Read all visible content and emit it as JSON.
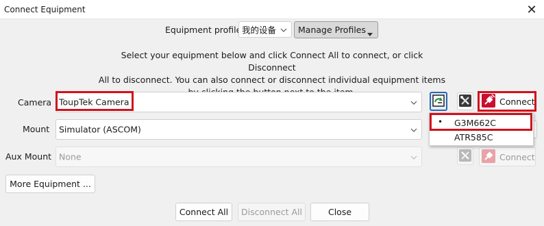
{
  "window": {
    "title": "Connect Equipment",
    "close_glyph": "✕"
  },
  "profile": {
    "label": "Equipment profile",
    "selected": "我的设备",
    "manage_label": "Manage Profiles"
  },
  "instructions": [
    "Select your equipment below and click Connect All to connect, or click Disconnect",
    "All to disconnect. You can also connect or disconnect individual equipment items",
    "by clicking the button next to the item."
  ],
  "rows": {
    "camera": {
      "label": "Camera",
      "value": "ToupTek Camera",
      "connect_label": "Connect"
    },
    "mount": {
      "label": "Mount",
      "value": "Simulator (ASCOM)"
    },
    "aux_mount": {
      "label": "Aux Mount",
      "value": "None",
      "connect_label": "Connect"
    }
  },
  "camera_menu": {
    "items": [
      {
        "bullet": "•",
        "label": "G3M662C"
      },
      {
        "bullet": "",
        "label": "ATR585C"
      }
    ]
  },
  "more_equipment_label": "More Equipment ...",
  "footer": {
    "connect_all": "Connect All",
    "disconnect_all": "Disconnect All",
    "close": "Close"
  },
  "colors": {
    "highlight": "#d0101b",
    "plug_icon": "#c8102e",
    "tool_icon_bg": "#3a3a3a",
    "refresh_icon": "#1d8f2b"
  },
  "icons": [
    "close-icon",
    "chevron-down-icon",
    "refresh-icon",
    "tools-icon",
    "plug-icon",
    "caret-down-icon"
  ]
}
